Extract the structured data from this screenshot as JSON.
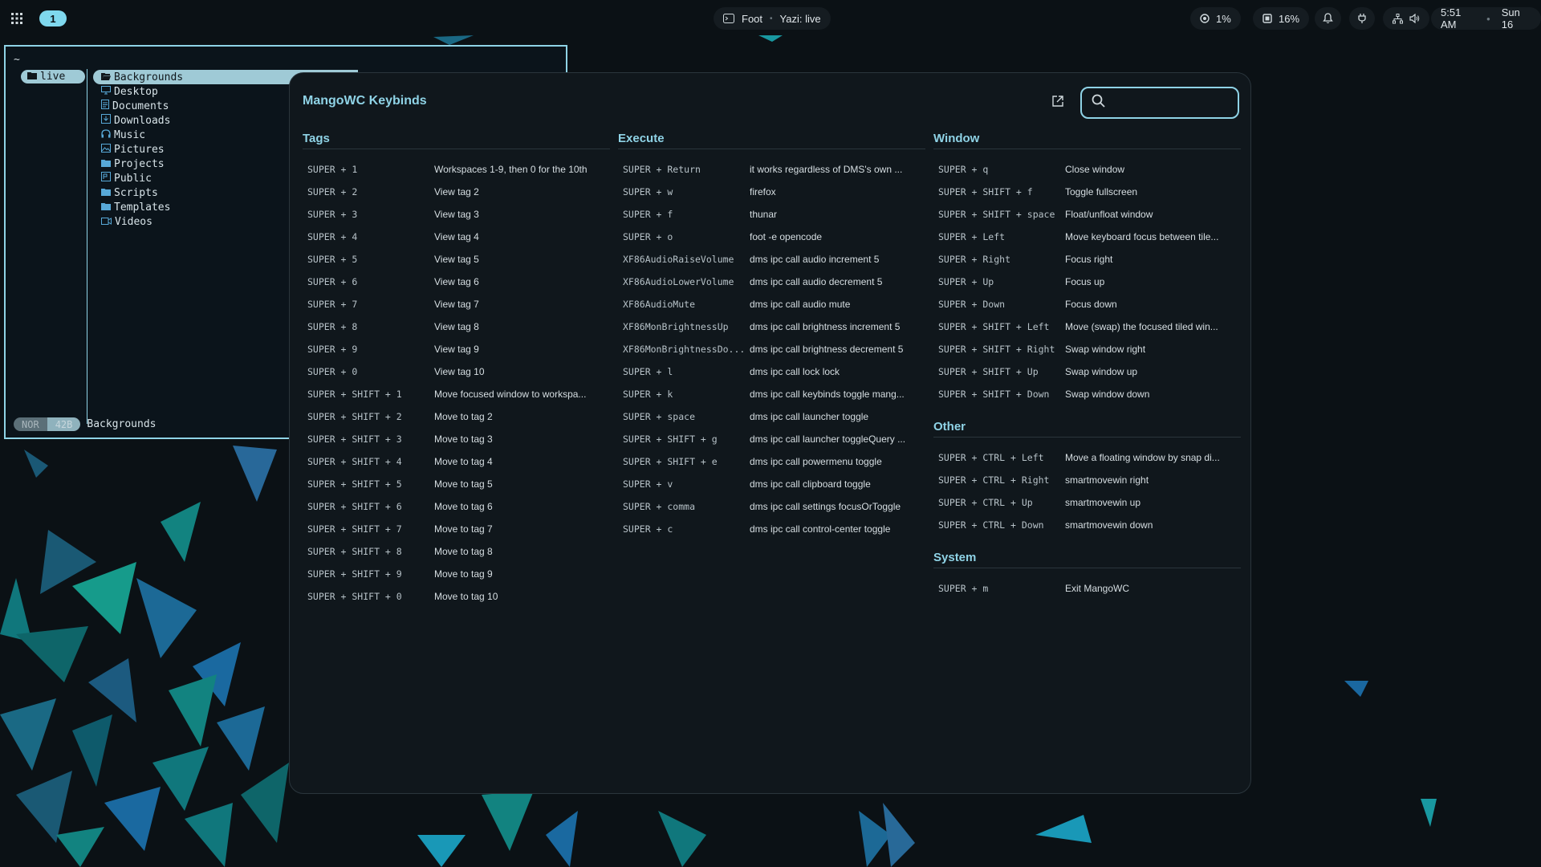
{
  "topbar": {
    "workspace": "1",
    "focused_app": "Foot",
    "focused_title": "Yazi: live",
    "cpu": "1%",
    "ram": "16%",
    "time": "5:51 AM",
    "date": "Sun 16"
  },
  "terminal": {
    "path": "~",
    "tab": "live",
    "files": [
      {
        "name": "Backgrounds",
        "icon": "folder-open-icon",
        "selected": true
      },
      {
        "name": "Desktop",
        "icon": "desktop-icon"
      },
      {
        "name": "Documents",
        "icon": "document-icon"
      },
      {
        "name": "Downloads",
        "icon": "download-icon"
      },
      {
        "name": "Music",
        "icon": "headphones-icon"
      },
      {
        "name": "Pictures",
        "icon": "picture-icon"
      },
      {
        "name": "Projects",
        "icon": "folder-icon"
      },
      {
        "name": "Public",
        "icon": "public-icon"
      },
      {
        "name": "Scripts",
        "icon": "folder-icon"
      },
      {
        "name": "Templates",
        "icon": "folder-icon"
      },
      {
        "name": "Videos",
        "icon": "video-icon"
      }
    ],
    "mode": "NOR",
    "mode_extra": "42B",
    "status_name": "Backgrounds"
  },
  "modal": {
    "title": "MangoWC Keybinds",
    "search_placeholder": "",
    "sections": {
      "tags": {
        "title": "Tags",
        "binds": [
          {
            "key": "SUPER + 1",
            "desc": "Workspaces 1-9, then 0 for the 10th"
          },
          {
            "key": "SUPER + 2",
            "desc": "View tag 2"
          },
          {
            "key": "SUPER + 3",
            "desc": "View tag 3"
          },
          {
            "key": "SUPER + 4",
            "desc": "View tag 4"
          },
          {
            "key": "SUPER + 5",
            "desc": "View tag 5"
          },
          {
            "key": "SUPER + 6",
            "desc": "View tag 6"
          },
          {
            "key": "SUPER + 7",
            "desc": "View tag 7"
          },
          {
            "key": "SUPER + 8",
            "desc": "View tag 8"
          },
          {
            "key": "SUPER + 9",
            "desc": "View tag 9"
          },
          {
            "key": "SUPER + 0",
            "desc": "View tag 10"
          },
          {
            "key": "SUPER + SHIFT + 1",
            "desc": "Move focused window to workspa..."
          },
          {
            "key": "SUPER + SHIFT + 2",
            "desc": "Move to tag 2"
          },
          {
            "key": "SUPER + SHIFT + 3",
            "desc": "Move to tag 3"
          },
          {
            "key": "SUPER + SHIFT + 4",
            "desc": "Move to tag 4"
          },
          {
            "key": "SUPER + SHIFT + 5",
            "desc": "Move to tag 5"
          },
          {
            "key": "SUPER + SHIFT + 6",
            "desc": "Move to tag 6"
          },
          {
            "key": "SUPER + SHIFT + 7",
            "desc": "Move to tag 7"
          },
          {
            "key": "SUPER + SHIFT + 8",
            "desc": "Move to tag 8"
          },
          {
            "key": "SUPER + SHIFT + 9",
            "desc": "Move to tag 9"
          },
          {
            "key": "SUPER + SHIFT + 0",
            "desc": "Move to tag 10"
          }
        ]
      },
      "execute": {
        "title": "Execute",
        "binds": [
          {
            "key": "SUPER + Return",
            "desc": "it works regardless of DMS's own ..."
          },
          {
            "key": "SUPER + w",
            "desc": "firefox"
          },
          {
            "key": "SUPER + f",
            "desc": "thunar"
          },
          {
            "key": "SUPER + o",
            "desc": "foot -e opencode"
          },
          {
            "key": "XF86AudioRaiseVolume",
            "desc": "dms ipc call audio increment 5"
          },
          {
            "key": "XF86AudioLowerVolume",
            "desc": "dms ipc call audio decrement 5"
          },
          {
            "key": "XF86AudioMute",
            "desc": "dms ipc call audio mute"
          },
          {
            "key": "XF86MonBrightnessUp",
            "desc": "dms ipc call brightness increment 5"
          },
          {
            "key": "XF86MonBrightnessDo...",
            "desc": "dms ipc call brightness decrement 5"
          },
          {
            "key": "SUPER + l",
            "desc": "dms ipc call lock lock"
          },
          {
            "key": "SUPER + k",
            "desc": "dms ipc call keybinds toggle mang..."
          },
          {
            "key": "SUPER + space",
            "desc": "dms ipc call launcher toggle"
          },
          {
            "key": "SUPER + SHIFT + g",
            "desc": "dms ipc call launcher toggleQuery ..."
          },
          {
            "key": "SUPER + SHIFT + e",
            "desc": "dms ipc call powermenu toggle"
          },
          {
            "key": "SUPER + v",
            "desc": "dms ipc call clipboard toggle"
          },
          {
            "key": "SUPER + comma",
            "desc": "dms ipc call settings focusOrToggle"
          },
          {
            "key": "SUPER + c",
            "desc": "dms ipc call control-center toggle"
          }
        ]
      },
      "window": {
        "title": "Window",
        "binds": [
          {
            "key": "SUPER + q",
            "desc": "Close window"
          },
          {
            "key": "SUPER + SHIFT + f",
            "desc": "Toggle fullscreen"
          },
          {
            "key": "SUPER + SHIFT + space",
            "desc": "Float/unfloat window"
          },
          {
            "key": "SUPER + Left",
            "desc": "Move keyboard focus between tile..."
          },
          {
            "key": "SUPER + Right",
            "desc": "Focus right"
          },
          {
            "key": "SUPER + Up",
            "desc": "Focus up"
          },
          {
            "key": "SUPER + Down",
            "desc": "Focus down"
          },
          {
            "key": "SUPER + SHIFT + Left",
            "desc": "Move (swap) the focused tiled win..."
          },
          {
            "key": "SUPER + SHIFT + Right",
            "desc": "Swap window right"
          },
          {
            "key": "SUPER + SHIFT + Up",
            "desc": "Swap window up"
          },
          {
            "key": "SUPER + SHIFT + Down",
            "desc": "Swap window down"
          }
        ]
      },
      "other": {
        "title": "Other",
        "binds": [
          {
            "key": "SUPER + CTRL + Left",
            "desc": "Move a floating window by snap di..."
          },
          {
            "key": "SUPER + CTRL + Right",
            "desc": "smartmovewin right"
          },
          {
            "key": "SUPER + CTRL + Up",
            "desc": "smartmovewin up"
          },
          {
            "key": "SUPER + CTRL + Down",
            "desc": "smartmovewin down"
          }
        ]
      },
      "system": {
        "title": "System",
        "binds": [
          {
            "key": "SUPER + m",
            "desc": "Exit MangoWC"
          }
        ]
      }
    }
  }
}
